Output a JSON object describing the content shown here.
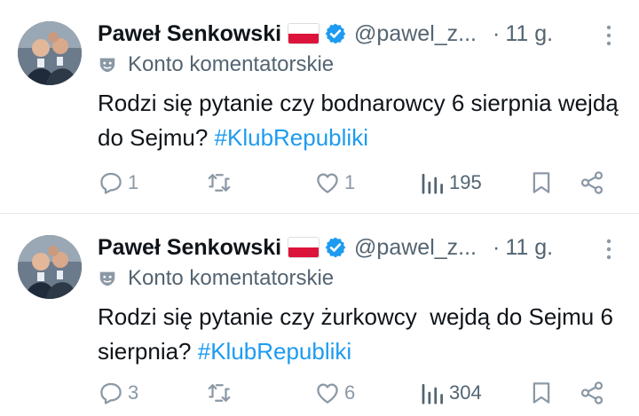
{
  "tweets": [
    {
      "author_name": "Paweł Senkowski",
      "flag_emoji": "poland-flag",
      "verified": true,
      "handle": "@pawel_z...",
      "dot": "·",
      "time": "11 g.",
      "account_label": "Konto komentatorskie",
      "text_plain": "Rodzi się pytanie czy bodnarowcy 6 sierpnia wejdą do Sejmu? ",
      "hashtag": "#KlubRepubliki",
      "replies": "1",
      "reposts": "",
      "likes": "1",
      "views": "195"
    },
    {
      "author_name": "Paweł Senkowski",
      "flag_emoji": "poland-flag",
      "verified": true,
      "handle": "@pawel_z...",
      "dot": "·",
      "time": "11 g.",
      "account_label": "Konto komentatorskie",
      "text_plain": "Rodzi się pytanie czy żurkowcy  wejdą do Sejmu 6 sierpnia? ",
      "hashtag": "#KlubRepubliki",
      "replies": "3",
      "reposts": "",
      "likes": "6",
      "views": "304"
    }
  ],
  "colors": {
    "text": "#0f1419",
    "secondary": "#536471",
    "hashtag": "#1d9bf0",
    "verified": "#1d9bf0",
    "action_icon": "#8b98a5",
    "divider": "#e6e9eb"
  }
}
